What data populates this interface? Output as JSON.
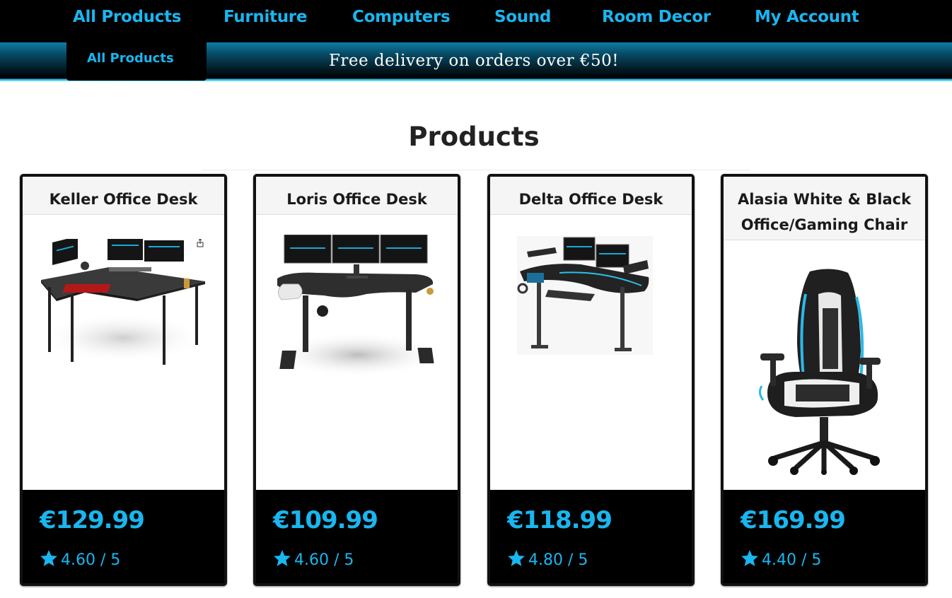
{
  "nav": {
    "items": [
      {
        "label": "All Products"
      },
      {
        "label": "Furniture"
      },
      {
        "label": "Computers"
      },
      {
        "label": "Sound"
      },
      {
        "label": "Room Decor"
      },
      {
        "label": "My Account"
      }
    ],
    "dropdown": {
      "items": [
        {
          "label": "All Products"
        }
      ]
    }
  },
  "banner": {
    "text": "Free delivery on orders over €50!"
  },
  "page": {
    "title": "Products"
  },
  "products": [
    {
      "name": "Keller Office Desk",
      "price": "€129.99",
      "rating": "4.60 / 5",
      "image": "l-shaped-desk-image"
    },
    {
      "name": "Loris Office Desk",
      "price": "€109.99",
      "rating": "4.60 / 5",
      "image": "gaming-desk-image"
    },
    {
      "name": "Delta Office Desk",
      "price": "€118.99",
      "rating": "4.80 / 5",
      "image": "corner-desk-image"
    },
    {
      "name_line1": "Alasia White & Black",
      "name_line2": "Office/Gaming Chair",
      "price": "€169.99",
      "rating": "4.40 / 5",
      "image": "gaming-chair-image"
    }
  ],
  "colors": {
    "accent": "#19b6f0",
    "nav_bg": "#000000",
    "banner_glow": "#3fc9f5"
  },
  "icons": {
    "rating": "star-icon"
  }
}
